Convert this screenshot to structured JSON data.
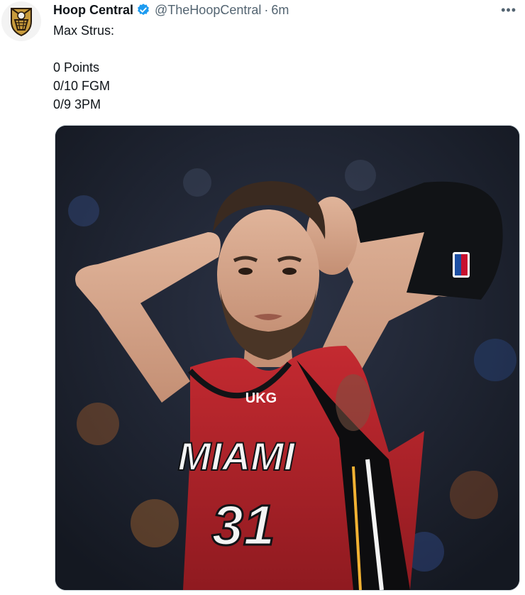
{
  "author": {
    "name": "Hoop Central",
    "handle": "@TheHoopCentral",
    "separator": "·",
    "time": "6m",
    "verified": true,
    "avatar_icon": "hoop-central-logo-icon"
  },
  "menu": {
    "more_label": "•••"
  },
  "tweet": {
    "lines": [
      "Max Strus:",
      "",
      "0 Points",
      "0/10 FGM",
      "0/9 3PM"
    ]
  },
  "media": {
    "jersey_text": "MIAMI",
    "jersey_number": "31",
    "sponsor": "UKG",
    "colors": {
      "jersey": "#b8242c",
      "background": "#1a1e2a",
      "verified": "#1d9bf0"
    }
  }
}
